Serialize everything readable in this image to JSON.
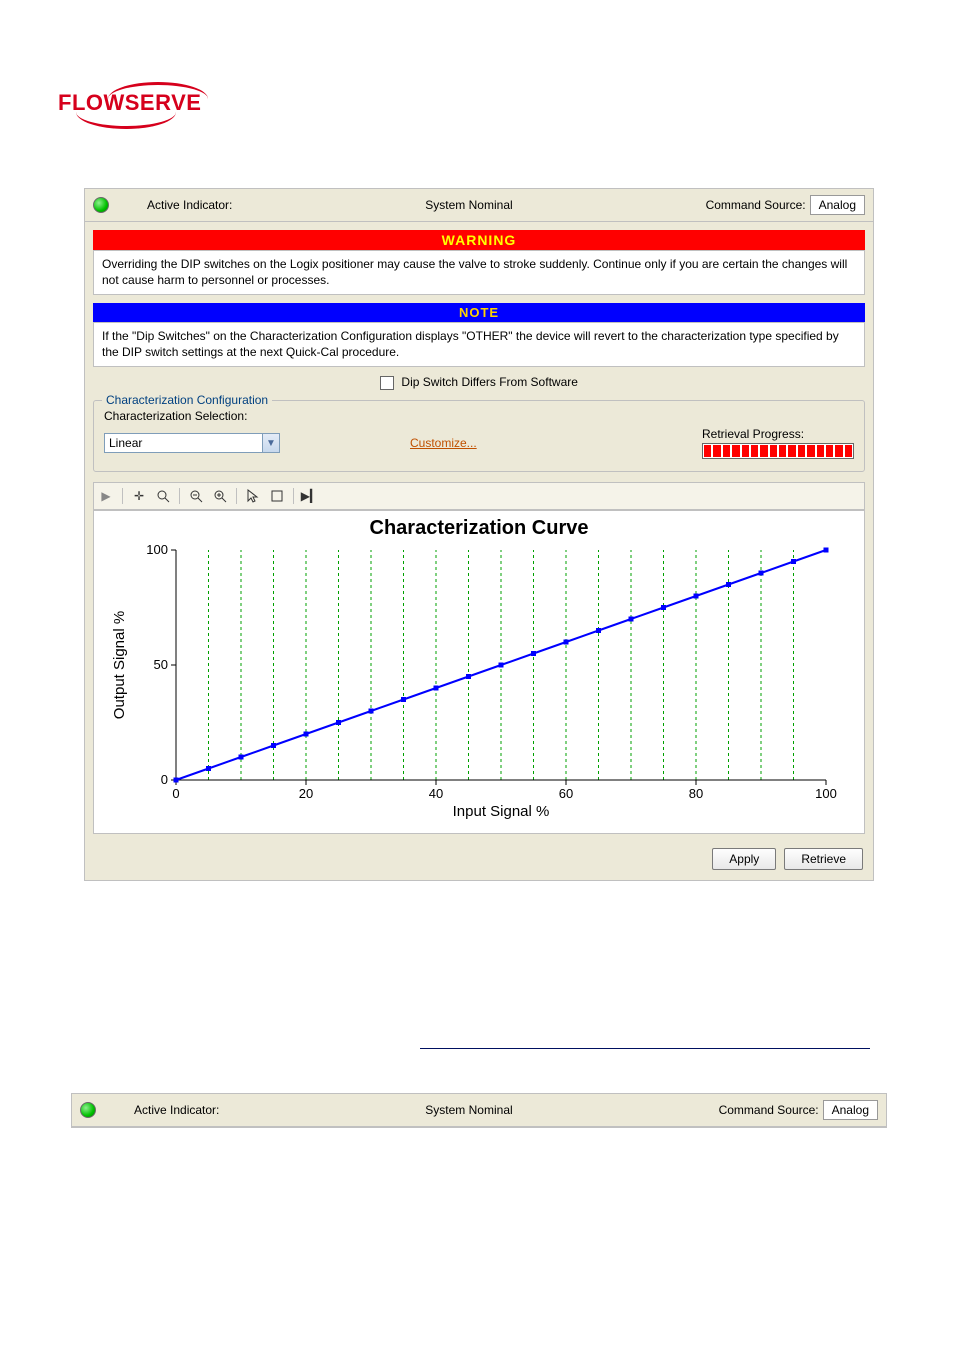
{
  "brand": "FLOWSERVE",
  "status": {
    "indicator_label": "Active Indicator:",
    "system_value": "System Nominal",
    "command_label": "Command Source:",
    "command_value": "Analog"
  },
  "warning": {
    "header": "WARNING",
    "body": "Overriding the DIP switches on the Logix positioner may cause the valve to stroke suddenly.  Continue only if you are certain the changes will not cause harm to personnel or processes."
  },
  "note": {
    "header": "NOTE",
    "body": "If the \"Dip Switches\" on the Characterization Configuration displays \"OTHER\" the device will revert to the characterization type specified by the DIP switch settings at the next Quick-Cal procedure."
  },
  "dip_label": "Dip Switch Differs From Software",
  "config": {
    "legend": "Characterization Configuration",
    "selection_label": "Characterization Selection:",
    "selection_value": "Linear",
    "customize_link": "Customize...",
    "progress_label": "Retrieval Progress:",
    "progress_segments": 16
  },
  "buttons": {
    "apply": "Apply",
    "retrieve": "Retrieve"
  },
  "chart_data": {
    "type": "line",
    "title": "Characterization Curve",
    "xlabel": "Input Signal %",
    "ylabel": "Output Signal %",
    "xlim": [
      0,
      100
    ],
    "ylim": [
      0,
      100
    ],
    "x_ticks": [
      0,
      20,
      40,
      60,
      80,
      100
    ],
    "y_ticks": [
      0,
      50,
      100
    ],
    "series": [
      {
        "name": "Linear",
        "color": "#0000ff",
        "x": [
          0,
          5,
          10,
          15,
          20,
          25,
          30,
          35,
          40,
          45,
          50,
          55,
          60,
          65,
          70,
          75,
          80,
          85,
          90,
          95,
          100
        ],
        "y": [
          0,
          5,
          10,
          15,
          20,
          25,
          30,
          35,
          40,
          45,
          50,
          55,
          60,
          65,
          70,
          75,
          80,
          85,
          90,
          95,
          100
        ]
      }
    ],
    "grid": {
      "x_minor_step": 5,
      "color": "#00a000",
      "style": "dashed"
    }
  }
}
